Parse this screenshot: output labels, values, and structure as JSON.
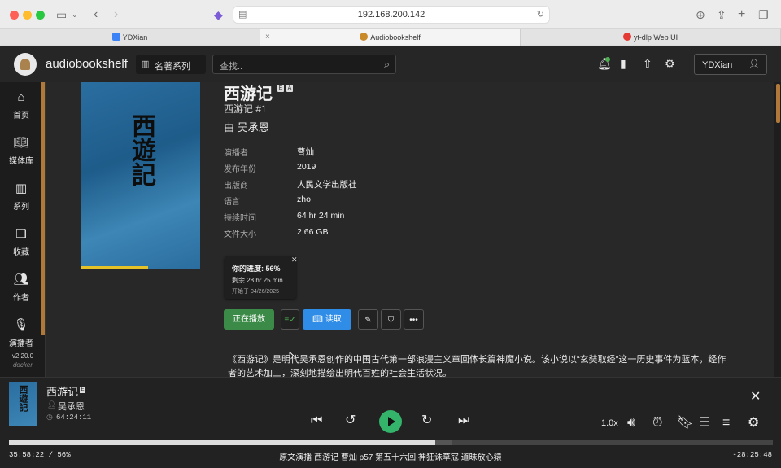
{
  "browser": {
    "address": "192.168.200.142",
    "tabs": [
      {
        "label": "YDXian",
        "color": "#3b82f6"
      },
      {
        "label": "Audiobookshelf",
        "color": "#c98a2a"
      },
      {
        "label": "yt-dlp Web UI",
        "color": "#e53935"
      }
    ]
  },
  "app": {
    "name": "audiobookshelf",
    "library": "名著系列",
    "search_placeholder": "查找..",
    "user": "YDXian"
  },
  "sidebar": {
    "items": [
      {
        "label": "首页",
        "icon": "home-icon"
      },
      {
        "label": "媒体库",
        "icon": "book-icon"
      },
      {
        "label": "系列",
        "icon": "columns-icon"
      },
      {
        "label": "收藏",
        "icon": "collection-icon"
      },
      {
        "label": "作者",
        "icon": "people-icon"
      },
      {
        "label": "演播者",
        "icon": "narrator-icon"
      }
    ],
    "version": "v2.20.0",
    "build": "docker"
  },
  "book": {
    "title": "西游记",
    "series": "西游记 #1",
    "author": "由 吴承恩",
    "cover_text": "西遊記",
    "meta": [
      {
        "key": "演播者",
        "value": "曹灿"
      },
      {
        "key": "发布年份",
        "value": "2019"
      },
      {
        "key": "出版商",
        "value": "人民文学出版社"
      },
      {
        "key": "语言",
        "value": "zho"
      },
      {
        "key": "持续时间",
        "value": "64 hr 24 min"
      },
      {
        "key": "文件大小",
        "value": "2.66 GB"
      }
    ],
    "progress": {
      "title": "你的进度: 56%",
      "remaining": "剩余 28 hr 25 min",
      "started": "开始于 04/26/2025",
      "percent": 56
    },
    "buttons": {
      "playing": "正在播放",
      "read": "读取"
    },
    "description": "《西游记》是明代吴承恩创作的中国古代第一部浪漫主义章回体长篇神魔小说。该小说以“玄奘取经”这一历史事件为蓝本，经作者的艺术加工，深刻地描绘出明代百姓的社会生活状况。"
  },
  "player": {
    "title": "西游记",
    "author": "吴承恩",
    "duration": "64:24:11",
    "speed": "1.0x",
    "elapsed": "35:58:22 / 56%",
    "remaining": "-28:25:48",
    "chapter": "原文演播 西游记 曹灿 p57 第五十六回 神狂诛草寇 道昧放心猿",
    "progress_fraction": 0.558,
    "buffered_fraction": 0.58
  }
}
